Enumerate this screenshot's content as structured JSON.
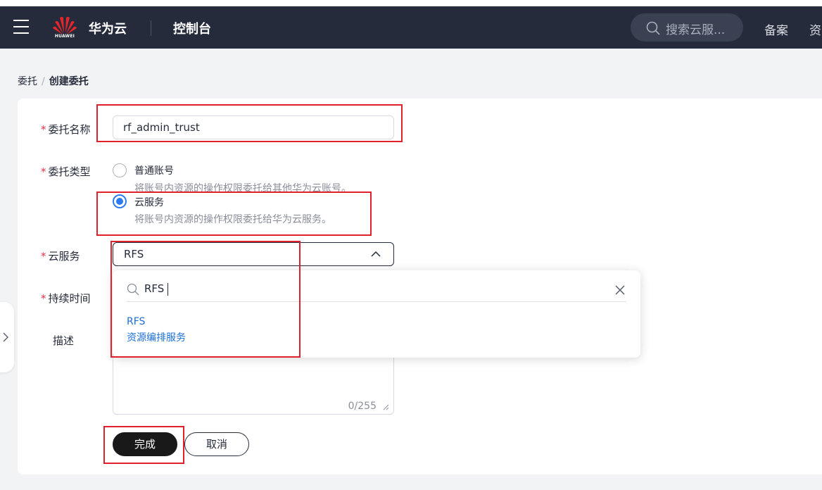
{
  "header": {
    "brand": "华为云",
    "logo_text": "HUAWEI",
    "console": "控制台",
    "search_placeholder": "搜索云服...",
    "nav_links": [
      "备案",
      "资"
    ]
  },
  "breadcrumb": {
    "parent": "委托",
    "separator": "/",
    "current": "创建委托"
  },
  "form": {
    "required_mark": "*",
    "trust_name": {
      "label": "委托名称",
      "value": "rf_admin_trust"
    },
    "trust_type": {
      "label": "委托类型",
      "options": [
        {
          "title": "普通账号",
          "desc": "将账号内资源的操作权限委托给其他华为云账号。",
          "checked": false
        },
        {
          "title": "云服务",
          "desc": "将账号内资源的操作权限委托给华为云服务。",
          "checked": true
        }
      ]
    },
    "cloud_service": {
      "label": "云服务",
      "value": "RFS",
      "dropdown": {
        "search_query": "RFS",
        "options": [
          {
            "name": "RFS",
            "desc": "资源编排服务"
          }
        ]
      }
    },
    "duration": {
      "label": "持续时间"
    },
    "description": {
      "label": "描述",
      "counter": "0/255"
    },
    "buttons": {
      "submit": "完成",
      "cancel": "取消"
    }
  },
  "colors": {
    "topbar": "#252b3a",
    "accent": "#2b7cf2",
    "link": "#1c70d8",
    "required": "#e3324a",
    "annotation": "#e0202b"
  }
}
